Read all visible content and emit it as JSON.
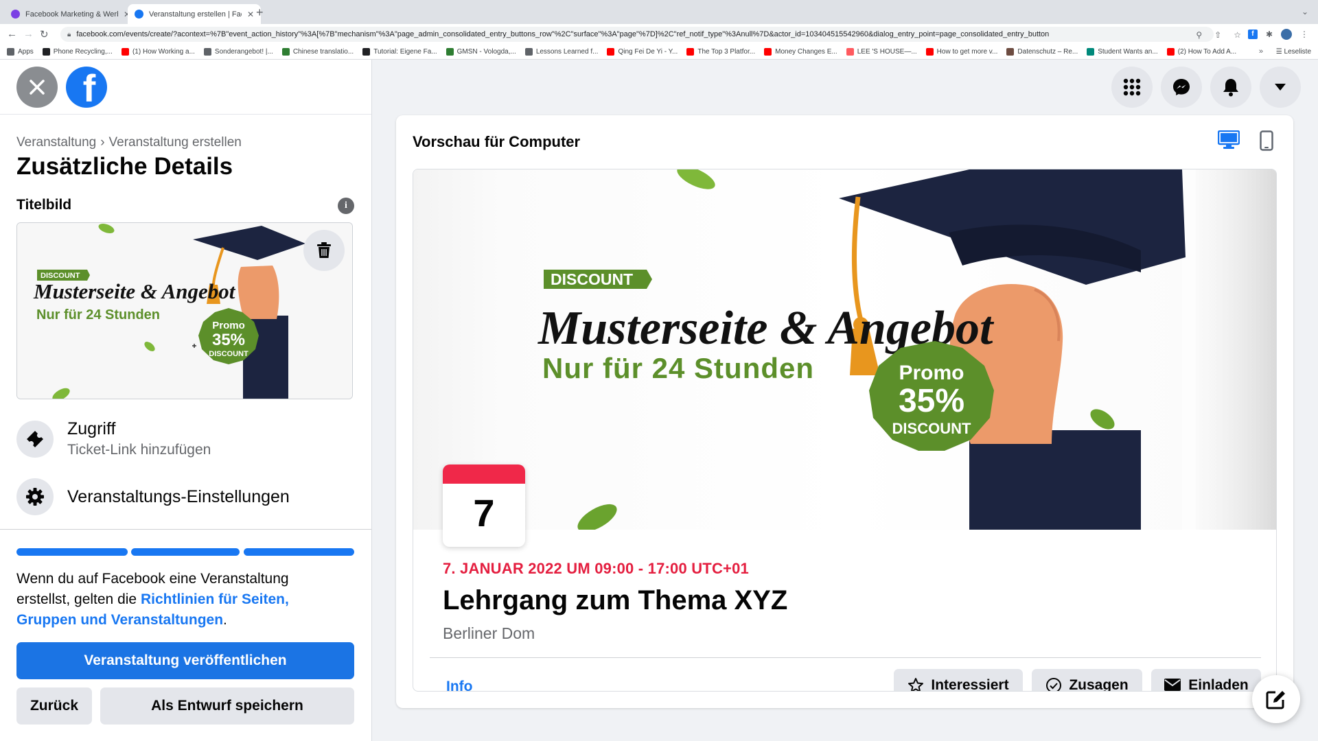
{
  "browser": {
    "tabs": [
      {
        "title": "Facebook Marketing & Werbea",
        "favicon_color": "#7b3fe4"
      },
      {
        "title": "Veranstaltung erstellen | Faceb",
        "favicon_color": "#1877f2"
      }
    ],
    "url": "facebook.com/events/create/?acontext=%7B\"event_action_history\"%3A[%7B\"mechanism\"%3A\"page_admin_consolidated_entry_buttons_row\"%2C\"surface\"%3A\"page\"%7D]%2C\"ref_notif_type\"%3Anull%7D&actor_id=103404515542960&dialog_entry_point=page_consolidated_entry_button",
    "bookmarks": [
      {
        "label": "Apps",
        "color": "#5f6368"
      },
      {
        "label": "Phone Recycling,...",
        "color": "#202124"
      },
      {
        "label": "(1) How Working a...",
        "color": "#ff0000"
      },
      {
        "label": "Sonderangebot! |...",
        "color": "#5f6368"
      },
      {
        "label": "Chinese translatio...",
        "color": "#2e7d32"
      },
      {
        "label": "Tutorial: Eigene Fa...",
        "color": "#202124"
      },
      {
        "label": "GMSN - Vologda,...",
        "color": "#2e7d32"
      },
      {
        "label": "Lessons Learned f...",
        "color": "#5f6368"
      },
      {
        "label": "Qing Fei De Yi - Y...",
        "color": "#ff0000"
      },
      {
        "label": "The Top 3 Platfor...",
        "color": "#ff0000"
      },
      {
        "label": "Money Changes E...",
        "color": "#ff0000"
      },
      {
        "label": "LEE 'S HOUSE—...",
        "color": "#ff5a5f"
      },
      {
        "label": "How to get more v...",
        "color": "#ff0000"
      },
      {
        "label": "Datenschutz – Re...",
        "color": "#6d4c41"
      },
      {
        "label": "Student Wants an...",
        "color": "#00897b"
      },
      {
        "label": "(2) How To Add A...",
        "color": "#ff0000"
      }
    ],
    "more_label": "»",
    "reading_list": "Leseliste"
  },
  "left": {
    "breadcrumb": [
      "Veranstaltung",
      "Veranstaltung erstellen"
    ],
    "breadcrumb_sep": "›",
    "title": "Zusätzliche Details",
    "cover_section": "Titelbild",
    "info_glyph": "i",
    "options": [
      {
        "title": "Zugriff",
        "subtitle": "Ticket-Link hinzufügen",
        "icon": "ticket-icon"
      },
      {
        "title": "Veranstaltungs-Einstellungen",
        "subtitle": "",
        "icon": "gear-icon"
      }
    ],
    "progress_steps_complete": 3,
    "policy_prefix": "Wenn du auf Facebook eine Veranstaltung erstellst, gelten die ",
    "policy_link": "Richtlinien für Seiten, Gruppen und Veranstaltungen",
    "policy_suffix": ".",
    "publish_button": "Veranstaltung veröffentlichen",
    "back_button": "Zurück",
    "draft_button": "Als Entwurf speichern"
  },
  "banner": {
    "badge": "DISCOUNT",
    "script": "Musterseite & Angebot",
    "subline": "Nur für 24 Stunden",
    "seal_top": "Promo",
    "seal_mid": "35%",
    "seal_bottom": "DISCOUNT",
    "colors": {
      "green": "#5c8f2a",
      "navy": "#1c2440",
      "skin": "#ec9a6a",
      "tassel": "#e8961e"
    }
  },
  "preview": {
    "title": "Vorschau für Computer",
    "day": "7",
    "date_line": "7. JANUAR 2022 UM 09:00 - 17:00 UTC+01",
    "event_title": "Lehrgang zum Thema XYZ",
    "location": "Berliner Dom",
    "tab_info": "Info",
    "btn_interested": "Interessiert",
    "btn_going": "Zusagen",
    "btn_invite": "Einladen"
  },
  "colors": {
    "accent": "#1877f2",
    "date_red": "#e41e3f",
    "bg": "#f0f2f5"
  }
}
